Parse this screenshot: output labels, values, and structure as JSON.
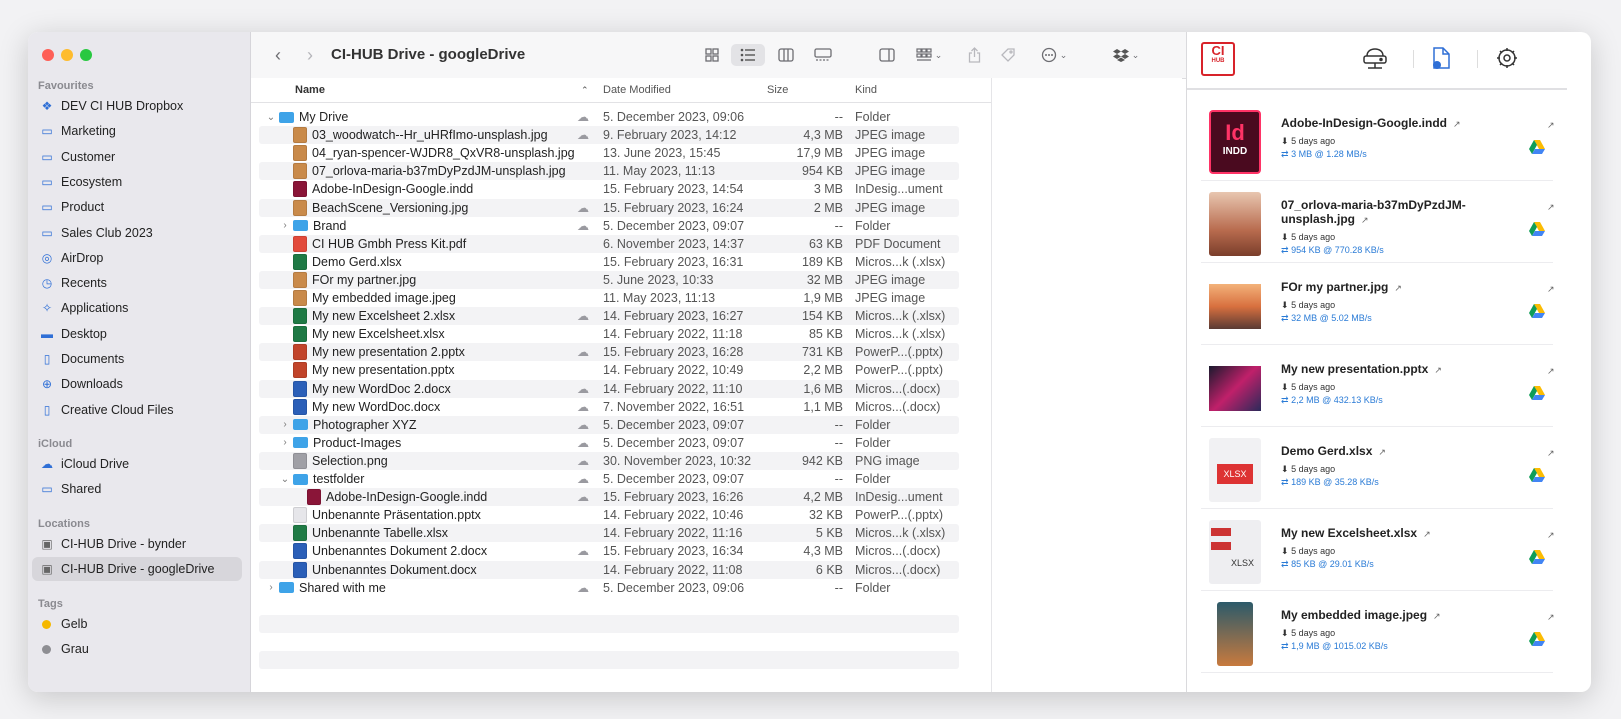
{
  "window": {
    "title": "CI-HUB Drive - googleDrive"
  },
  "sidebar": {
    "favourites_label": "Favourites",
    "favourites": [
      {
        "label": "DEV CI HUB Dropbox",
        "icon": "dropbox-icon"
      },
      {
        "label": "Marketing",
        "icon": "folder-icon"
      },
      {
        "label": "Customer",
        "icon": "folder-icon"
      },
      {
        "label": "Ecosystem",
        "icon": "folder-icon"
      },
      {
        "label": "Product",
        "icon": "folder-icon"
      },
      {
        "label": "Sales Club 2023",
        "icon": "folder-icon"
      },
      {
        "label": "AirDrop",
        "icon": "airdrop-icon"
      },
      {
        "label": "Recents",
        "icon": "clock-icon"
      },
      {
        "label": "Applications",
        "icon": "applications-icon"
      },
      {
        "label": "Desktop",
        "icon": "desktop-icon"
      },
      {
        "label": "Documents",
        "icon": "document-icon"
      },
      {
        "label": "Downloads",
        "icon": "download-icon"
      },
      {
        "label": "Creative Cloud Files",
        "icon": "file-icon"
      }
    ],
    "icloud_label": "iCloud",
    "icloud": [
      {
        "label": "iCloud Drive",
        "icon": "cloud-icon"
      },
      {
        "label": "Shared",
        "icon": "shared-folder-icon"
      }
    ],
    "locations_label": "Locations",
    "locations": [
      {
        "label": "CI-HUB Drive - bynder",
        "icon": "drive-icon"
      },
      {
        "label": "CI-HUB Drive - googleDrive",
        "icon": "drive-icon",
        "selected": true
      }
    ],
    "tags_label": "Tags",
    "tags": [
      {
        "label": "Gelb",
        "color": "#f5b800"
      },
      {
        "label": "Grau",
        "color": "#8e8e93"
      }
    ]
  },
  "columns": {
    "name": "Name",
    "date": "Date Modified",
    "size": "Size",
    "kind": "Kind"
  },
  "files": [
    {
      "name": "My Drive",
      "date": "5. December 2023, 09:06",
      "size": "--",
      "kind": "Folder",
      "depth": 0,
      "disclosure": "open",
      "type": "folder",
      "cloud": true
    },
    {
      "name": "03_woodwatch--Hr_uHRfImo-unsplash.jpg",
      "date": "9. February 2023, 14:12",
      "size": "4,3 MB",
      "kind": "JPEG image",
      "depth": 1,
      "type": "jpg",
      "cloud": true
    },
    {
      "name": "04_ryan-spencer-WJDR8_QxVR8-unsplash.jpg",
      "date": "13. June 2023, 15:45",
      "size": "17,9 MB",
      "kind": "JPEG image",
      "depth": 1,
      "type": "jpg",
      "cloud": false
    },
    {
      "name": "07_orlova-maria-b37mDyPzdJM-unsplash.jpg",
      "date": "11. May 2023, 11:13",
      "size": "954 KB",
      "kind": "JPEG image",
      "depth": 1,
      "type": "jpg",
      "cloud": false
    },
    {
      "name": "Adobe-InDesign-Google.indd",
      "date": "15. February 2023, 14:54",
      "size": "3 MB",
      "kind": "InDesig...ument",
      "depth": 1,
      "type": "indd",
      "cloud": false
    },
    {
      "name": "BeachScene_Versioning.jpg",
      "date": "15. February 2023, 16:24",
      "size": "2 MB",
      "kind": "JPEG image",
      "depth": 1,
      "type": "jpg",
      "cloud": true
    },
    {
      "name": "Brand",
      "date": "5. December 2023, 09:07",
      "size": "--",
      "kind": "Folder",
      "depth": 1,
      "disclosure": "closed",
      "type": "folder",
      "cloud": true
    },
    {
      "name": "CI HUB Gmbh Press Kit.pdf",
      "date": "6. November 2023, 14:37",
      "size": "63 KB",
      "kind": "PDF Document",
      "depth": 1,
      "type": "pdf",
      "cloud": false
    },
    {
      "name": "Demo Gerd.xlsx",
      "date": "15. February 2023, 16:31",
      "size": "189 KB",
      "kind": "Micros...k (.xlsx)",
      "depth": 1,
      "type": "xlsx",
      "cloud": false
    },
    {
      "name": "FOr my partner.jpg",
      "date": "5. June 2023, 10:33",
      "size": "32 MB",
      "kind": "JPEG image",
      "depth": 1,
      "type": "jpg",
      "cloud": false
    },
    {
      "name": "My embedded image.jpeg",
      "date": "11. May 2023, 11:13",
      "size": "1,9 MB",
      "kind": "JPEG image",
      "depth": 1,
      "type": "jpg",
      "cloud": false
    },
    {
      "name": "My new Excelsheet 2.xlsx",
      "date": "14. February 2023, 16:27",
      "size": "154 KB",
      "kind": "Micros...k (.xlsx)",
      "depth": 1,
      "type": "xlsx",
      "cloud": true
    },
    {
      "name": "My new Excelsheet.xlsx",
      "date": "14. February 2022, 11:18",
      "size": "85 KB",
      "kind": "Micros...k (.xlsx)",
      "depth": 1,
      "type": "xlsx",
      "cloud": false
    },
    {
      "name": "My new presentation 2.pptx",
      "date": "15. February 2023, 16:28",
      "size": "731 KB",
      "kind": "PowerP...(.pptx)",
      "depth": 1,
      "type": "pptx",
      "cloud": true
    },
    {
      "name": "My new presentation.pptx",
      "date": "14. February 2022, 10:49",
      "size": "2,2 MB",
      "kind": "PowerP...(.pptx)",
      "depth": 1,
      "type": "pptx",
      "cloud": false
    },
    {
      "name": "My new WordDoc 2.docx",
      "date": "14. February 2022, 11:10",
      "size": "1,6 MB",
      "kind": "Micros...(.docx)",
      "depth": 1,
      "type": "docx",
      "cloud": true
    },
    {
      "name": "My new WordDoc.docx",
      "date": "7. November 2022, 16:51",
      "size": "1,1 MB",
      "kind": "Micros...(.docx)",
      "depth": 1,
      "type": "docx",
      "cloud": true
    },
    {
      "name": "Photographer XYZ",
      "date": "5. December 2023, 09:07",
      "size": "--",
      "kind": "Folder",
      "depth": 1,
      "disclosure": "closed",
      "type": "folder",
      "cloud": true
    },
    {
      "name": "Product-Images",
      "date": "5. December 2023, 09:07",
      "size": "--",
      "kind": "Folder",
      "depth": 1,
      "disclosure": "closed",
      "type": "folder",
      "cloud": true
    },
    {
      "name": "Selection.png",
      "date": "30. November 2023, 10:32",
      "size": "942 KB",
      "kind": "PNG image",
      "depth": 1,
      "type": "png",
      "cloud": true
    },
    {
      "name": "testfolder",
      "date": "5. December 2023, 09:07",
      "size": "--",
      "kind": "Folder",
      "depth": 1,
      "disclosure": "open",
      "type": "folder",
      "cloud": true
    },
    {
      "name": "Adobe-InDesign-Google.indd",
      "date": "15. February 2023, 16:26",
      "size": "4,2 MB",
      "kind": "InDesig...ument",
      "depth": 2,
      "type": "indd",
      "cloud": true
    },
    {
      "name": "Unbenannte Präsentation.pptx",
      "date": "14. February 2022, 10:46",
      "size": "32 KB",
      "kind": "PowerP...(.pptx)",
      "depth": 1,
      "type": "pptx-blank",
      "cloud": false
    },
    {
      "name": "Unbenannte Tabelle.xlsx",
      "date": "14. February 2022, 11:16",
      "size": "5 KB",
      "kind": "Micros...k (.xlsx)",
      "depth": 1,
      "type": "xlsx",
      "cloud": false
    },
    {
      "name": "Unbenanntes Dokument 2.docx",
      "date": "15. February 2023, 16:34",
      "size": "4,3 MB",
      "kind": "Micros...(.docx)",
      "depth": 1,
      "type": "docx",
      "cloud": true
    },
    {
      "name": "Unbenanntes Dokument.docx",
      "date": "14. February 2022, 11:08",
      "size": "6 KB",
      "kind": "Micros...(.docx)",
      "depth": 1,
      "type": "docx",
      "cloud": false
    },
    {
      "name": "Shared with me",
      "date": "5. December 2023, 09:06",
      "size": "--",
      "kind": "Folder",
      "depth": 0,
      "disclosure": "closed",
      "type": "folder",
      "cloud": true
    }
  ],
  "panel": {
    "logo_text": "CI",
    "logo_sub": "HUB",
    "cards": [
      {
        "title": "Adobe-InDesign-Google.indd",
        "meta": "5 days ago",
        "transfer": "3 MB @ 1.28 MB/s",
        "thumb": "indd",
        "thumb_label_big": "Id",
        "thumb_label_small": "INDD"
      },
      {
        "title": "07_orlova-maria-b37mDyPzdJM-unsplash.jpg",
        "meta": "5 days ago",
        "transfer": "954 KB @ 770.28 KB/s",
        "thumb": "interior"
      },
      {
        "title": "FOr my partner.jpg",
        "meta": "5 days ago",
        "transfer": "32 MB @ 5.02 MB/s",
        "thumb": "beach"
      },
      {
        "title": "My new presentation.pptx",
        "meta": "5 days ago",
        "transfer": "2,2 MB @ 432.13 KB/s",
        "thumb": "presentation"
      },
      {
        "title": "Demo Gerd.xlsx",
        "meta": "5 days ago",
        "transfer": "189 KB @ 35.28 KB/s",
        "thumb": "xlsx",
        "thumb_label_small": "XLSX"
      },
      {
        "title": "My new Excelsheet.xlsx",
        "meta": "5 days ago",
        "transfer": "85 KB @ 29.01 KB/s",
        "thumb": "xlsx2",
        "thumb_label_small": "XLSX"
      },
      {
        "title": "My embedded image.jpeg",
        "meta": "5 days ago",
        "transfer": "1,9 MB @ 1015.02 KB/s",
        "thumb": "phone"
      }
    ]
  },
  "colors": {
    "accent": "#2f6fd6",
    "brand_red": "#d8232a",
    "folder": "#3ea3e8"
  }
}
